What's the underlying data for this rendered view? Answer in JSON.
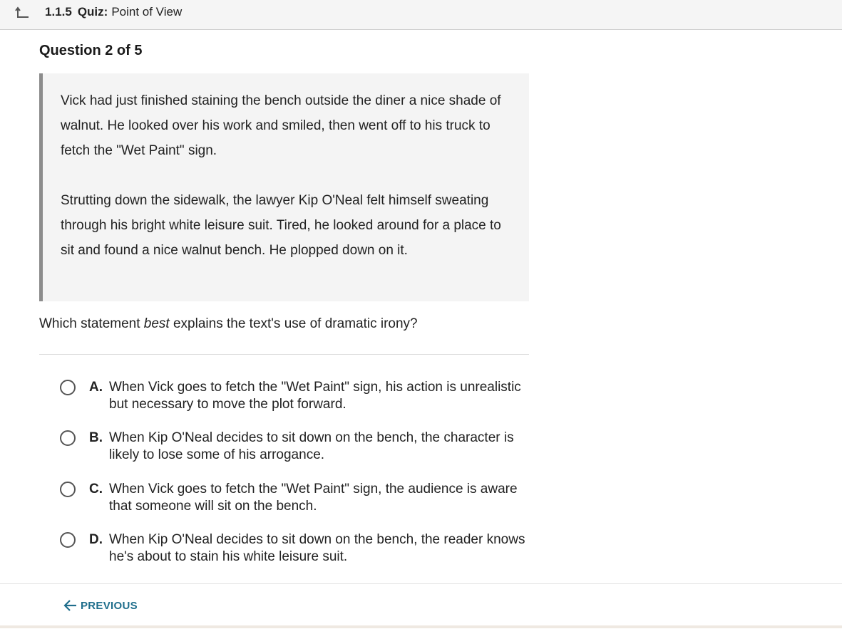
{
  "header": {
    "back_icon": "back-arrow-icon",
    "quiz_number": "1.1.5",
    "quiz_kind": "Quiz:",
    "quiz_name": "Point of View"
  },
  "question": {
    "counter": "Question 2 of 5",
    "passage": [
      "Vick had just finished staining the bench outside the diner a nice shade of walnut. He looked over his work and smiled, then went off to his truck to fetch the \"Wet Paint\" sign.",
      "Strutting down the sidewalk, the lawyer Kip O'Neal felt himself sweating through his bright white leisure suit. Tired, he looked around for a place to sit and found a nice walnut bench. He plopped down on it."
    ],
    "prompt_before": "Which statement ",
    "prompt_emphasis": "best",
    "prompt_after": " explains the text's use of dramatic irony?"
  },
  "options": [
    {
      "letter": "A.",
      "text": "When Vick goes to fetch the \"Wet Paint\" sign, his action is unrealistic but necessary to move the plot forward."
    },
    {
      "letter": "B.",
      "text": "When Kip O'Neal decides to sit down on the bench, the character is likely to lose some of his arrogance."
    },
    {
      "letter": "C.",
      "text": "When Vick goes to fetch the \"Wet Paint\" sign, the audience is aware that someone will sit on the bench."
    },
    {
      "letter": "D.",
      "text": "When Kip O'Neal decides to sit down on the bench, the reader knows he's about to stain his white leisure suit."
    }
  ],
  "footer": {
    "previous_label": "PREVIOUS",
    "previous_icon": "arrow-left-icon"
  },
  "colors": {
    "accent": "#1f6e8c",
    "passage_bg": "#f4f4f4",
    "passage_border": "#8c8c8c"
  }
}
